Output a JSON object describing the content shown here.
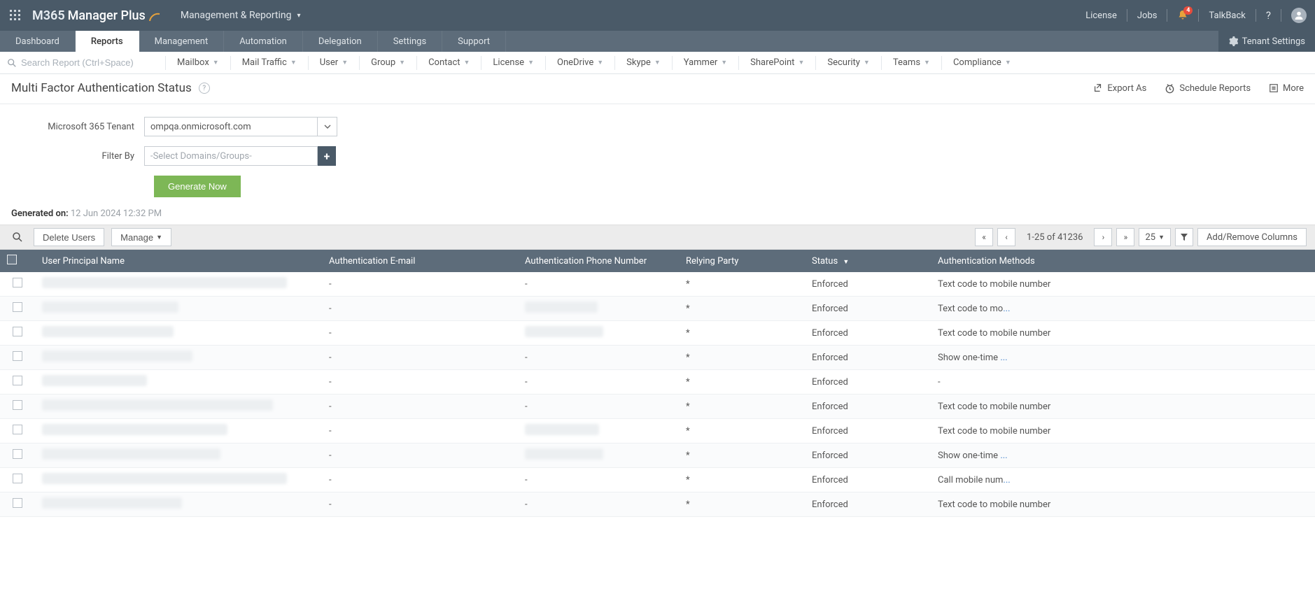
{
  "header": {
    "brand_prefix": "M365",
    "brand_suffix": "Manager Plus",
    "nav_dropdown_label": "Management & Reporting",
    "links": {
      "license": "License",
      "jobs": "Jobs",
      "talkback": "TalkBack"
    },
    "bell_badge": "4"
  },
  "tabs": {
    "items": [
      "Dashboard",
      "Reports",
      "Management",
      "Automation",
      "Delegation",
      "Settings",
      "Support"
    ],
    "active_index": 1,
    "tenant_settings": "Tenant Settings"
  },
  "subbar": {
    "search_placeholder": "Search Report (Ctrl+Space)",
    "items": [
      "Mailbox",
      "Mail Traffic",
      "User",
      "Group",
      "Contact",
      "License",
      "OneDrive",
      "Skype",
      "Yammer",
      "SharePoint",
      "Security",
      "Teams",
      "Compliance"
    ]
  },
  "page": {
    "title": "Multi Factor Authentication Status",
    "export_as": "Export As",
    "schedule_reports": "Schedule Reports",
    "more": "More"
  },
  "form": {
    "tenant_label": "Microsoft 365 Tenant",
    "tenant_value": "ompqa.onmicrosoft.com",
    "filter_by_label": "Filter By",
    "filter_by_placeholder": "-Select Domains/Groups-",
    "generate_label": "Generate Now"
  },
  "generated": {
    "label": "Generated on:",
    "value": "12 Jun 2024 12:32 PM"
  },
  "toolbar": {
    "delete_users": "Delete Users",
    "manage": "Manage",
    "pagination_info": "1-25 of 41236",
    "page_size": "25",
    "add_remove_columns": "Add/Remove Columns"
  },
  "table": {
    "columns": {
      "upn": "User Principal Name",
      "email": "Authentication E-mail",
      "phone": "Authentication Phone Number",
      "relying": "Relying Party",
      "status": "Status",
      "methods": "Authentication Methods"
    },
    "rows": [
      {
        "upn_redact_w": 350,
        "email": "-",
        "phone": "-",
        "phone_redact_w": 0,
        "relying": "*",
        "status": "Enforced",
        "methods": "Text code to mobile number",
        "methods_link": false
      },
      {
        "upn_redact_w": 195,
        "email": "-",
        "phone": "",
        "phone_redact_w": 104,
        "relying": "*",
        "status": "Enforced",
        "methods": "Text code to mo...",
        "methods_link": true
      },
      {
        "upn_redact_w": 188,
        "email": "-",
        "phone": "",
        "phone_redact_w": 112,
        "relying": "*",
        "status": "Enforced",
        "methods": "Text code to mobile number",
        "methods_link": false
      },
      {
        "upn_redact_w": 215,
        "email": "-",
        "phone": "-",
        "phone_redact_w": 0,
        "relying": "*",
        "status": "Enforced",
        "methods": "Show one-time ...",
        "methods_link": true
      },
      {
        "upn_redact_w": 150,
        "email": "-",
        "phone": "-",
        "phone_redact_w": 0,
        "relying": "*",
        "status": "Enforced",
        "methods": "-",
        "methods_link": false
      },
      {
        "upn_redact_w": 330,
        "email": "-",
        "phone": "-",
        "phone_redact_w": 0,
        "relying": "*",
        "status": "Enforced",
        "methods": "Text code to mobile number",
        "methods_link": false
      },
      {
        "upn_redact_w": 265,
        "email": "-",
        "phone": "",
        "phone_redact_w": 106,
        "relying": "*",
        "status": "Enforced",
        "methods": "Text code to mobile number",
        "methods_link": false
      },
      {
        "upn_redact_w": 255,
        "email": "-",
        "phone": "",
        "phone_redact_w": 112,
        "relying": "*",
        "status": "Enforced",
        "methods": "Show one-time ...",
        "methods_link": true
      },
      {
        "upn_redact_w": 350,
        "email": "-",
        "phone": "-",
        "phone_redact_w": 0,
        "relying": "*",
        "status": "Enforced",
        "methods": "Call mobile num...",
        "methods_link": true
      },
      {
        "upn_redact_w": 200,
        "email": "-",
        "phone": "-",
        "phone_redact_w": 0,
        "relying": "*",
        "status": "Enforced",
        "methods": "Text code to mobile number",
        "methods_link": false
      }
    ]
  }
}
